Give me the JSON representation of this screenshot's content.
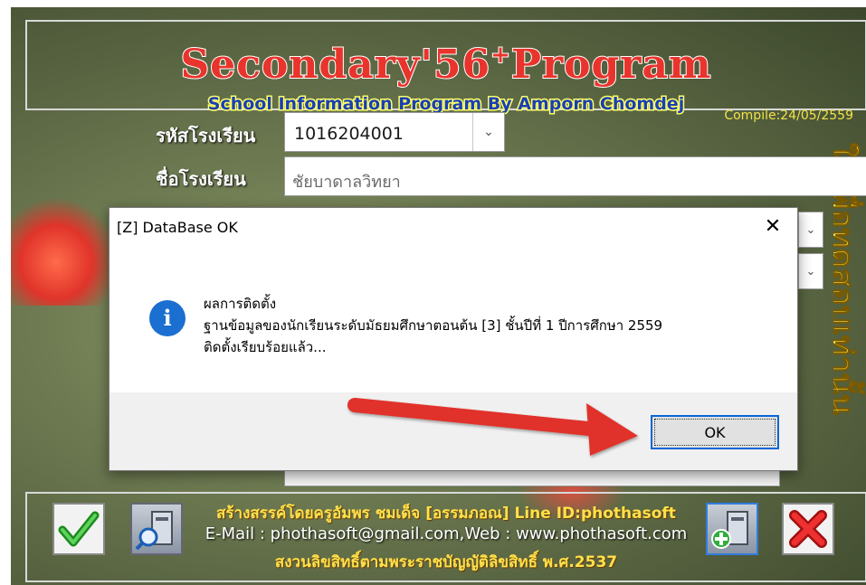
{
  "app": {
    "title": "Secondary'56",
    "title_plus": "+",
    "title_tail": "Program",
    "subtitle": "School Information Program By Amporn Chomdej",
    "compile": "Compile:24/05/2559",
    "side_banner": "ใช้เพื่อทดสอบเท่านั้น"
  },
  "form": {
    "school_code_label": "รหัสโรงเรียน",
    "school_code_value": "1016204001",
    "school_name_label": "ชื่อโรงเรียน",
    "school_name_value": "ชัยบาดาลวิทยา"
  },
  "footer": {
    "line1": "สร้างสรรค์โดยครูอัมพร  ชมเด็จ [อรรมภอณ] Line ID:phothasoft",
    "line2": "E-Mail : phothasoft@gmail.com,Web : www.phothasoft.com",
    "line3": "สงวนลิขสิทธิ์ตามพระราชบัญญัติลิขสิทธิ์ พ.ศ.2537"
  },
  "dialog": {
    "title": "[Z] DataBase OK",
    "close": "✕",
    "info_glyph": "i",
    "line1": "ผลการติดตั้ง",
    "line2": "ฐานข้อมูลของนักเรียนระดับมัธยมศึกษาตอนต้น [3]  ชั้นปีที่ 1  ปีการศึกษา 2559",
    "line3": "ติดตั้งเรียบร้อยแล้ว...",
    "ok_label": "OK"
  },
  "colors": {
    "accent": "#0a66d6",
    "arrow": "#e0322a",
    "title_red": "#e8342c",
    "subtitle_blue": "#1a3fb5"
  },
  "icons": {
    "combo": "chevron-down-icon",
    "info": "info-icon",
    "confirm": "checkmark-icon",
    "search": "database-search-icon",
    "add": "database-add-icon",
    "exit": "close-x-icon"
  }
}
